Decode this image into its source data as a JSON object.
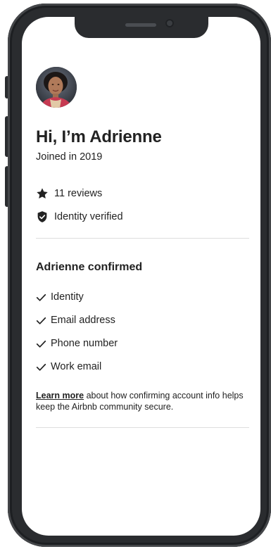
{
  "profile": {
    "headline": "Hi, I’m Adrienne",
    "joined": "Joined in 2019",
    "avatar_icon": "profile-photo"
  },
  "stats": {
    "reviews": {
      "icon": "star-icon",
      "label": "11 reviews"
    },
    "identity": {
      "icon": "shield-check-icon",
      "label": "Identity verified"
    }
  },
  "confirmed": {
    "title": "Adrienne confirmed",
    "items": [
      {
        "icon": "checkmark-icon",
        "label": "Identity"
      },
      {
        "icon": "checkmark-icon",
        "label": "Email address"
      },
      {
        "icon": "checkmark-icon",
        "label": "Phone number"
      },
      {
        "icon": "checkmark-icon",
        "label": "Work email"
      }
    ]
  },
  "footnote": {
    "link": "Learn more",
    "text": " about how confirming account info helps keep the Airbnb community secure."
  },
  "colors": {
    "text": "#222222",
    "divider": "#dddddd",
    "device": "#2a2c2f"
  }
}
